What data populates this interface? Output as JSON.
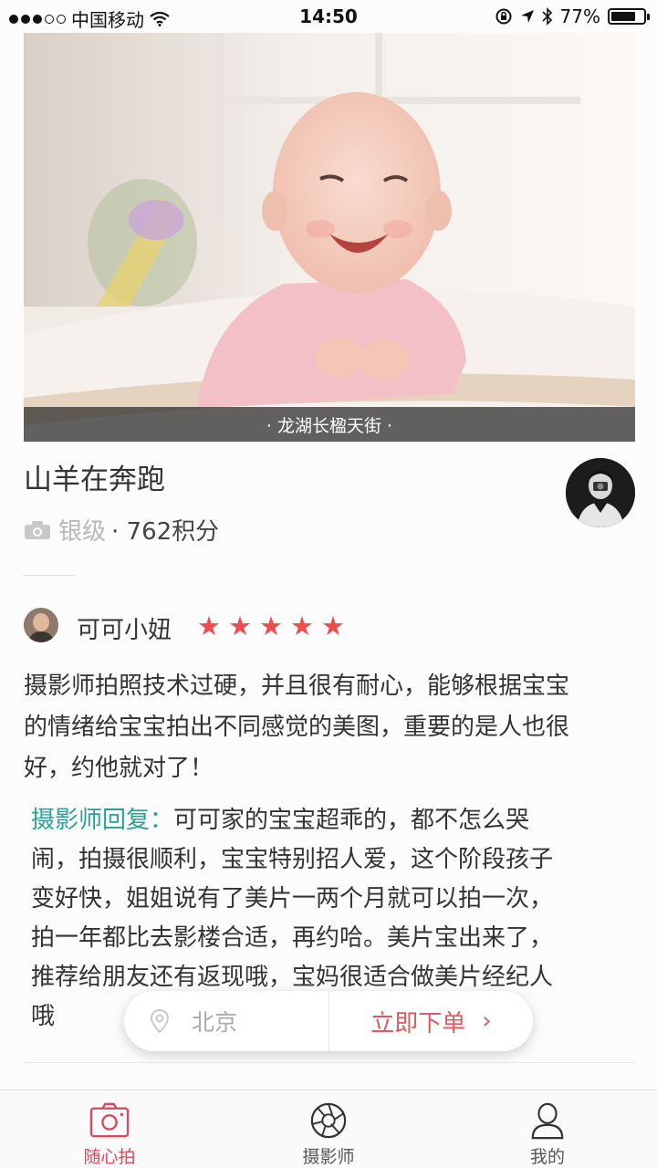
{
  "status_bar": {
    "carrier": "中国移动",
    "time": "14:50",
    "battery": "77%",
    "battery_level": 0.77
  },
  "hero": {
    "caption": "· 龙湖长楹天街 ·"
  },
  "photographer": {
    "name": "山羊在奔跑",
    "level": "银级",
    "points": "· 762积分"
  },
  "review": {
    "reviewer": "可可小妞",
    "rating": 5,
    "stars": [
      "★",
      "★",
      "★",
      "★",
      "★"
    ],
    "lines": [
      "摄影师拍照技术过硬，并且很有耐心，能够根据宝宝",
      "的情绪给宝宝拍出不同感觉的美图，重要的是人也很",
      "好，约他就对了！"
    ],
    "reply_label": "摄影师回复：",
    "reply_lines": [
      "可可家的宝宝超乖的，都不怎么哭",
      "闹，拍摄很顺利，宝宝特别招人爱，这个阶段孩子",
      "变好快，姐姐说有了美片一两个月就可以拍一次，",
      "拍一年都比去影楼合适，再约哈。美片宝出来了，",
      "推荐给朋友还有返现哦，宝妈很适合做美片经纪人",
      "哦"
    ]
  },
  "action_pill": {
    "city": "北京",
    "order_label": "立即下单",
    "order_arrow": "›"
  },
  "tabs": [
    {
      "label": "随心拍",
      "icon": "camera-icon",
      "active": true
    },
    {
      "label": "摄影师",
      "icon": "aperture-icon",
      "active": false
    },
    {
      "label": "我的",
      "icon": "user-icon",
      "active": false
    }
  ],
  "colors": {
    "accent": "#d94a5a",
    "star": "#ef4c4c",
    "reply_label": "#2aa198"
  }
}
